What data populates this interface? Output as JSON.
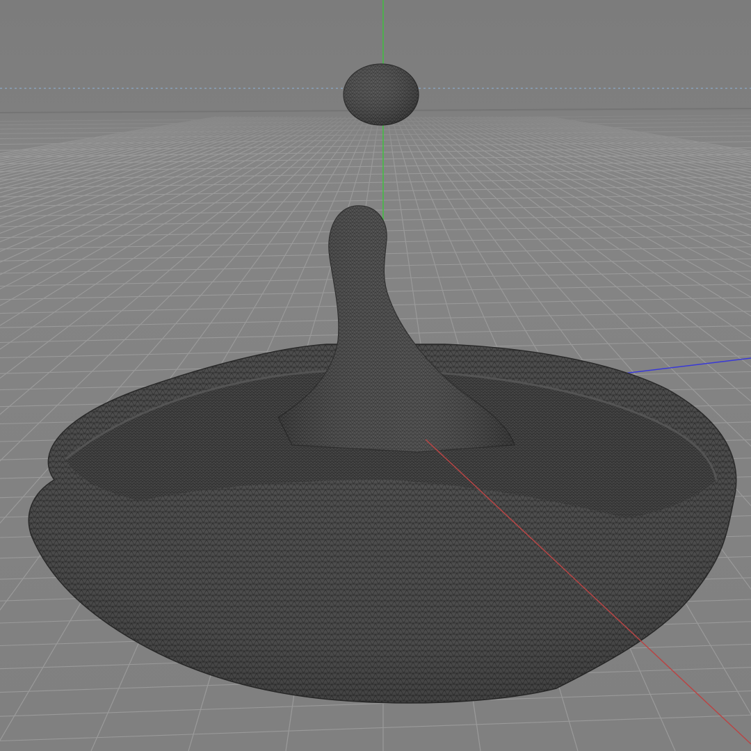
{
  "viewport": {
    "view": "perspective",
    "display_mode": "wireframe",
    "colors": {
      "background": "#808080",
      "background_horizon": "#8a8a8a",
      "grid_line": "#9a9a9a",
      "horizon_line": "#777777",
      "mesh_fill": "#4c4c4c",
      "mesh_line": "#2e2e2e",
      "mesh_highlight": "#5e5e5e",
      "axis_x": "#c04040",
      "axis_y": "#40c040",
      "axis_z": "#3a3ad8",
      "guide_line": "#88a0b8"
    },
    "scene_objects": [
      {
        "name": "droplet-sphere",
        "type": "sphere-mesh"
      },
      {
        "name": "splash-column",
        "type": "fluid-mesh"
      },
      {
        "name": "splash-crown-pool",
        "type": "fluid-mesh"
      }
    ],
    "axes": [
      "x-axis",
      "y-axis",
      "z-axis"
    ],
    "grid": true
  }
}
